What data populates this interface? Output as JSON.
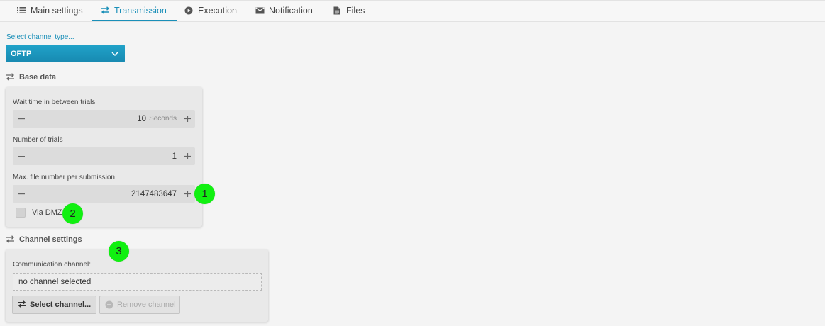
{
  "tabs": [
    {
      "label": "Main settings",
      "icon": "list-icon"
    },
    {
      "label": "Transmission",
      "icon": "transfer-icon"
    },
    {
      "label": "Execution",
      "icon": "play-circle-icon"
    },
    {
      "label": "Notification",
      "icon": "envelope-icon"
    },
    {
      "label": "Files",
      "icon": "file-icon"
    }
  ],
  "active_tab": "Transmission",
  "channel_type": {
    "label": "Select channel type...",
    "value": "OFTP"
  },
  "base_data": {
    "title": "Base data",
    "wait_time": {
      "label": "Wait time in between trials",
      "value": "10",
      "unit": "Seconds"
    },
    "trials": {
      "label": "Number of trials",
      "value": "1"
    },
    "max_files": {
      "label": "Max. file number per submission",
      "value": "2147483647"
    },
    "via_dmz": {
      "label": "Via DMZ",
      "checked": false
    }
  },
  "channel_settings": {
    "title": "Channel settings",
    "comm_label": "Communication channel:",
    "comm_value": "no channel selected",
    "select_button": "Select channel...",
    "remove_button": "Remove channel"
  },
  "markers": [
    "1",
    "2",
    "3"
  ],
  "colors": {
    "accent": "#1a8fb8",
    "marker": "#11f011"
  }
}
